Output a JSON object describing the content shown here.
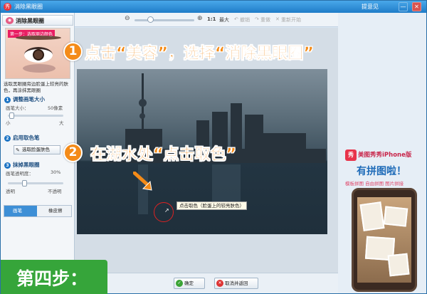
{
  "window": {
    "title": "消除黑眼圈",
    "feedback": "提意见",
    "minimize": "—",
    "close": "✕"
  },
  "toolbar": {
    "zoom_ratio": "1:1",
    "max": "最大",
    "undo": "撤销",
    "redo": "重做",
    "reset": "重新开始"
  },
  "sidebar": {
    "header": "消除黑眼圈",
    "example_tag": "第一步：选取周边颜色",
    "description": "选取黑眼圈旁边脸蛋上较亮的肤色，再涂抹黑眼圈",
    "step1": {
      "num": "1",
      "title": "调整画笔大小",
      "label": "画笔大小：",
      "value": "50像素",
      "min": "小",
      "max": "大"
    },
    "step2": {
      "num": "2",
      "title": "启用取色笔",
      "button": "选取脸蛋肤色"
    },
    "step3": {
      "num": "3",
      "title": "抹掉黑眼圈",
      "label": "画笔透明度：",
      "value": "30%",
      "min": "透明",
      "max": "不透明"
    },
    "tools": {
      "pen": "画笔",
      "eraser": "橡皮擦"
    }
  },
  "canvas": {
    "tooltip": "点击取色（脸蛋上的较亮肤色）"
  },
  "bottom": {
    "confirm": "确定",
    "cancel": "取消并返回"
  },
  "annotations": {
    "one_num": "1",
    "one_text": "点击“美容”，选择“消除黑眼圈”",
    "two_num": "2",
    "two_text": "在湖水处“点击取色”",
    "step4": "第四步："
  },
  "ad": {
    "app": "美图秀秀iPhone版",
    "headline": "有拼图啦！",
    "features": "模板拼图 自由拼图 图片拼接"
  },
  "colors": {
    "accent": "#f48b18",
    "step_banner": "#36a53a",
    "titlebar": "#1f7cc8"
  }
}
